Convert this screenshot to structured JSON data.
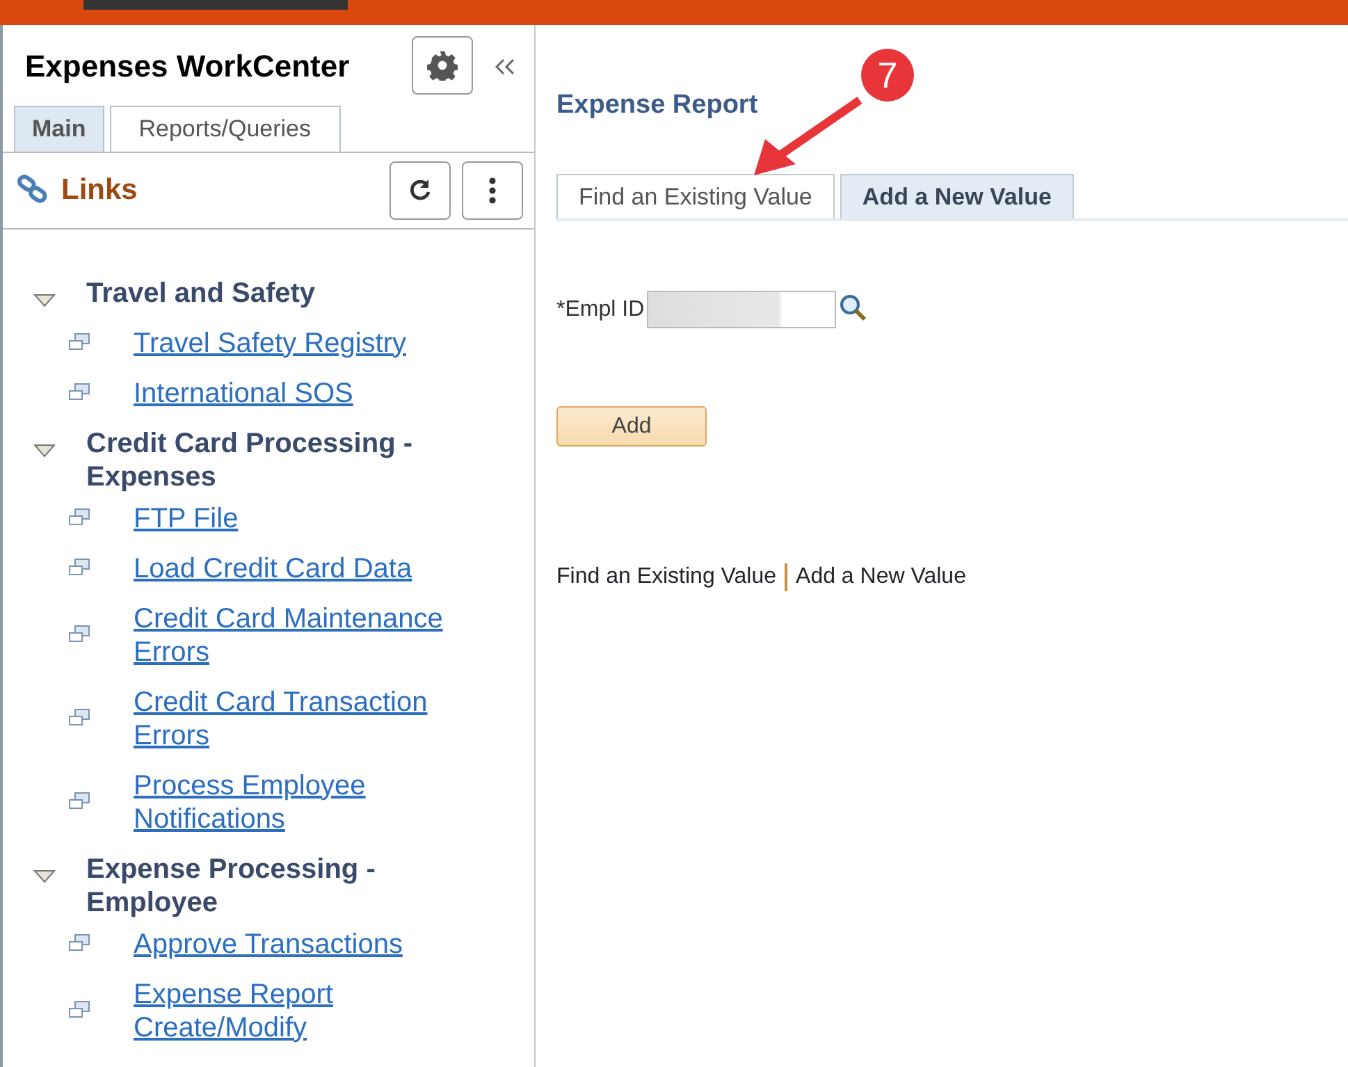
{
  "sidebar": {
    "title": "Expenses WorkCenter",
    "tabs": [
      {
        "label": "Main",
        "selected": true
      },
      {
        "label": "Reports/Queries",
        "selected": false
      }
    ],
    "links_header": "Links",
    "groups": [
      {
        "label": "Travel and Safety",
        "expanded": true,
        "children": [
          {
            "label": "Travel Safety Registry"
          },
          {
            "label": "International SOS"
          }
        ]
      },
      {
        "label": "Credit Card Processing - Expenses",
        "expanded": true,
        "children": [
          {
            "label": "FTP File"
          },
          {
            "label": "Load Credit Card Data"
          },
          {
            "label": "Credit Card Maintenance Errors"
          },
          {
            "label": "Credit Card Transaction Errors"
          },
          {
            "label": "Process Employee Notifications"
          }
        ]
      },
      {
        "label": "Expense Processing - Employee",
        "expanded": true,
        "children": [
          {
            "label": "Approve Transactions"
          },
          {
            "label": "Expense Report Create/Modify"
          }
        ]
      }
    ]
  },
  "content": {
    "title": "Expense Report",
    "tabs": [
      {
        "label": "Find an Existing Value",
        "selected": false
      },
      {
        "label": "Add a New Value",
        "selected": true
      }
    ],
    "field_label": "*Empl ID",
    "button": "Add",
    "links": [
      "Find an Existing Value",
      "Add a New Value"
    ]
  },
  "callout": {
    "number": "7"
  }
}
